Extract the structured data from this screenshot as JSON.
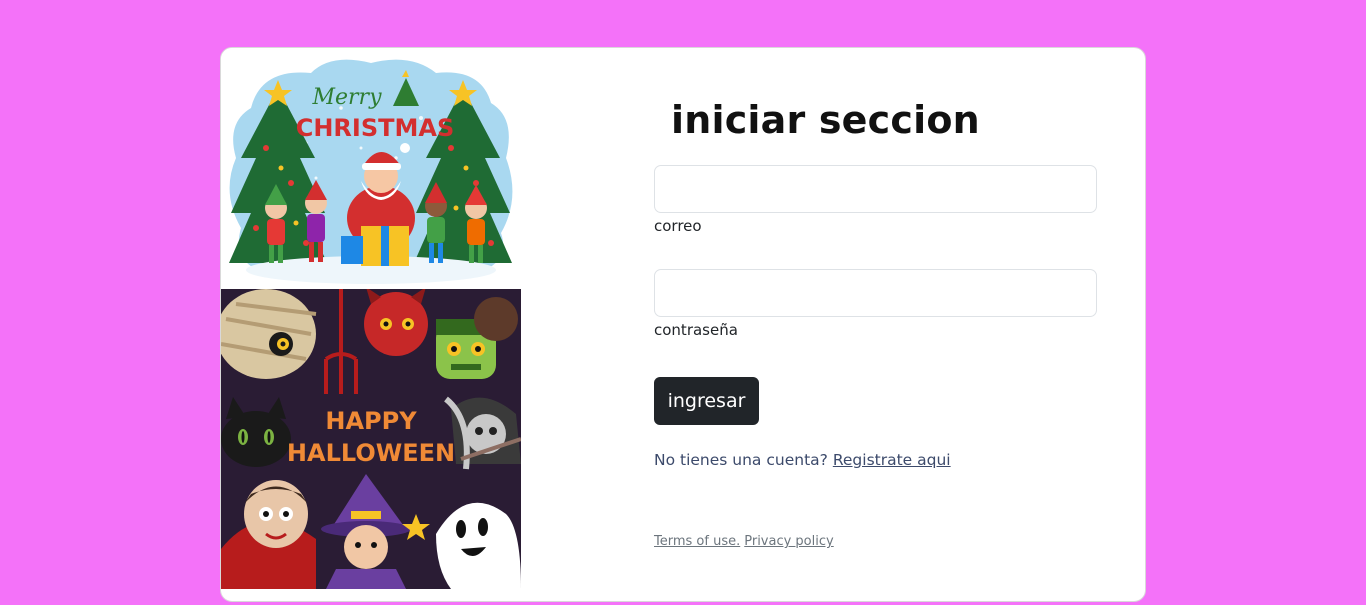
{
  "images": {
    "christmas": {
      "banner_line1": "Merry",
      "banner_line2": "CHRISTMAS"
    },
    "halloween": {
      "line1": "HAPPY",
      "line2": "HALLOWEEN"
    }
  },
  "form": {
    "title": "iniciar seccion",
    "email_value": "",
    "email_label": "correo",
    "password_value": "",
    "password_label": "contraseña",
    "submit_label": "ingresar",
    "register_prompt": "No tienes una cuenta?",
    "register_link": "Registrate aqui"
  },
  "footer": {
    "terms": "Terms of use.",
    "privacy": "Privacy policy"
  },
  "colors": {
    "page_background": "#f472f9",
    "card_background": "#ffffff",
    "button_background": "#212529",
    "button_text": "#ffffff"
  }
}
